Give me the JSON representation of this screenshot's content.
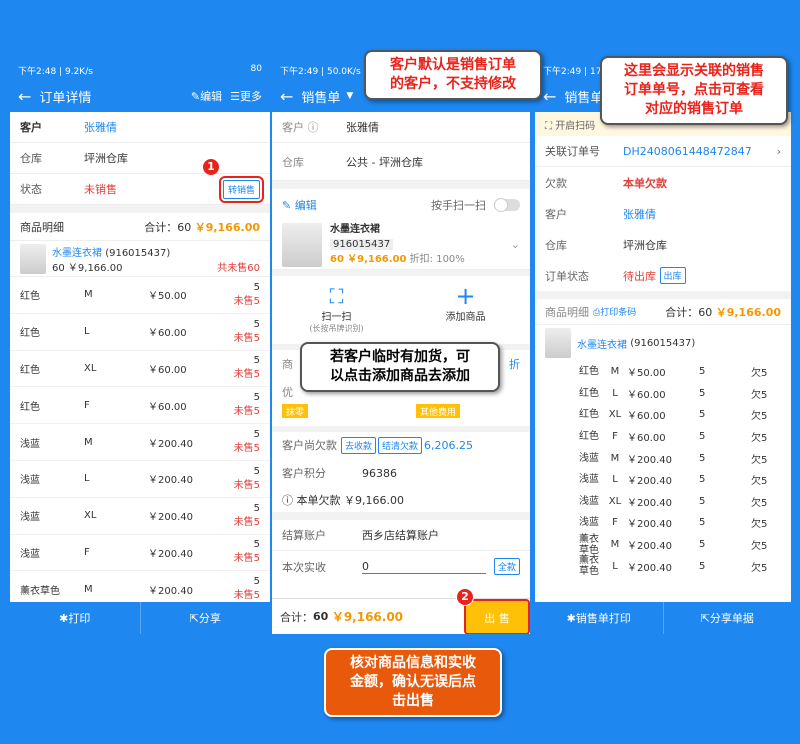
{
  "p1": {
    "status_time": "下午2:48",
    "status_net": "9.2K/s",
    "status_right": "80",
    "title": "订单详情",
    "edit": "编辑",
    "more": "更多",
    "customer_label": "客户",
    "customer": "张雅倩",
    "warehouse_label": "仓库",
    "warehouse": "坪洲仓库",
    "state_label": "状态",
    "state": "未销售",
    "convert_btn": "转销售",
    "detail_label": "商品明细",
    "total_label": "合计：60",
    "total_amount": "￥9,166.00",
    "product_name": "水墨连衣裙",
    "product_code": "(916015437)",
    "product_sub": "60 ￥9,166.00",
    "product_unsold": "共未售60",
    "rows": [
      {
        "color": "红色",
        "size": "M",
        "price": "￥50.00",
        "qty": "5",
        "unsold": "未售5"
      },
      {
        "color": "红色",
        "size": "L",
        "price": "￥60.00",
        "qty": "5",
        "unsold": "未售5"
      },
      {
        "color": "红色",
        "size": "XL",
        "price": "￥60.00",
        "qty": "5",
        "unsold": "未售5"
      },
      {
        "color": "红色",
        "size": "F",
        "price": "￥60.00",
        "qty": "5",
        "unsold": "未售5"
      },
      {
        "color": "浅蓝",
        "size": "M",
        "price": "￥200.40",
        "qty": "5",
        "unsold": "未售5"
      },
      {
        "color": "浅蓝",
        "size": "L",
        "price": "￥200.40",
        "qty": "5",
        "unsold": "未售5"
      },
      {
        "color": "浅蓝",
        "size": "XL",
        "price": "￥200.40",
        "qty": "5",
        "unsold": "未售5"
      },
      {
        "color": "浅蓝",
        "size": "F",
        "price": "￥200.40",
        "qty": "5",
        "unsold": "未售5"
      },
      {
        "color": "薰衣草色",
        "size": "M",
        "price": "￥200.40",
        "qty": "5",
        "unsold": "未售5"
      }
    ],
    "print": "打印",
    "share": "分享"
  },
  "p2": {
    "status_time": "下午2:49",
    "status_net": "50.0K/s",
    "title": "销售单",
    "customer_label": "客户",
    "customer": "张雅倩",
    "warehouse_label": "仓库",
    "warehouse": "公共 - 坪洲仓库",
    "edit": "编辑",
    "manual_scan": "按手扫一扫",
    "product_name": "水墨连衣裙",
    "product_code": "916015437",
    "product_qty": "60",
    "product_amount": "￥9,166.00",
    "discount": "折扣: 100%",
    "scan": "扫一扫",
    "scan_sub": "(长按吊牌识别)",
    "add_product": "添加商品",
    "partial_1": "商",
    "partial_2": "优",
    "partial_discount": "折",
    "tag_wipe": "抹零",
    "tag_other": "其他费用",
    "debt_label": "客户尚欠款",
    "debt_receive": "去收款",
    "debt_clear": "结清欠款",
    "debt_amount": "6,206.25",
    "points_label": "客户积分",
    "points": "96386",
    "this_debt": "本单欠款 ￥9,166.00",
    "account_label": "结算账户",
    "account": "西乡店结算账户",
    "paid_label": "本次实收",
    "paid": "0",
    "all_btn": "全款",
    "footer_total_label": "合计：",
    "footer_qty": "60",
    "footer_amount": "￥9,166.00",
    "sell_btn": "出 售"
  },
  "p3": {
    "status_time": "下午2:49",
    "status_net": "17.",
    "title": "销售单",
    "banner": "开启扫码",
    "linked_label": "关联订单号",
    "linked": "DH2408061448472847",
    "debt_label": "欠款",
    "debt": "本单欠款",
    "customer_label": "客户",
    "customer": "张雅倩",
    "warehouse_label": "仓库",
    "warehouse": "坪洲仓库",
    "state_label": "订单状态",
    "state": "待出库",
    "state_tag": "出库",
    "detail_label": "商品明细",
    "print_code": "打印条码",
    "total_label": "合计：60",
    "total_amount": "￥9,166.00",
    "product_name": "水墨连衣裙",
    "product_code": "(916015437)",
    "rows": [
      {
        "color": "红色",
        "size": "M",
        "price": "￥50.00",
        "qty": "5",
        "owe": "欠5"
      },
      {
        "color": "红色",
        "size": "L",
        "price": "￥60.00",
        "qty": "5",
        "owe": "欠5"
      },
      {
        "color": "红色",
        "size": "XL",
        "price": "￥60.00",
        "qty": "5",
        "owe": "欠5"
      },
      {
        "color": "红色",
        "size": "F",
        "price": "￥60.00",
        "qty": "5",
        "owe": "欠5"
      },
      {
        "color": "浅蓝",
        "size": "M",
        "price": "￥200.40",
        "qty": "5",
        "owe": "欠5"
      },
      {
        "color": "浅蓝",
        "size": "L",
        "price": "￥200.40",
        "qty": "5",
        "owe": "欠5"
      },
      {
        "color": "浅蓝",
        "size": "XL",
        "price": "￥200.40",
        "qty": "5",
        "owe": "欠5"
      },
      {
        "color": "浅蓝",
        "size": "F",
        "price": "￥200.40",
        "qty": "5",
        "owe": "欠5"
      },
      {
        "color": "薰衣草色",
        "size": "M",
        "price": "￥200.40",
        "qty": "5",
        "owe": "欠5"
      },
      {
        "color": "薰衣草色",
        "size": "L",
        "price": "￥200.40",
        "qty": "5",
        "owe": "欠5"
      }
    ],
    "print": "销售单打印",
    "share": "分享单据"
  },
  "callouts": {
    "c1_line1": "客户默认是销售订单",
    "c1_line2": "的客户，不支持修改",
    "c2_line1": "这里会显示关联的销售",
    "c2_line2": "订单单号，点击可查看",
    "c2_line3": "对应的销售订单",
    "c3_line1": "若客户临时有加货，可",
    "c3_line2": "以点击添加商品去添加",
    "c4_line1": "核对商品信息和实收",
    "c4_line2": "金额，确认无误后点",
    "c4_line3": "击出售",
    "badge1": "1",
    "badge2": "2"
  }
}
